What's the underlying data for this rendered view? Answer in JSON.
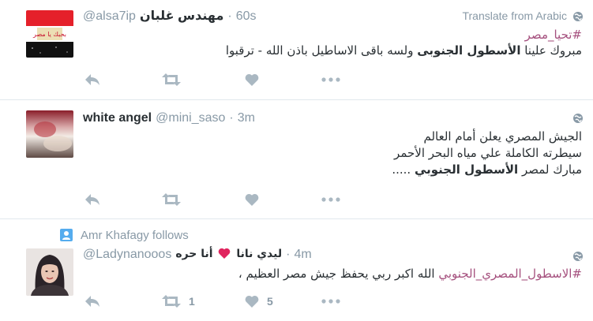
{
  "tweets": [
    {
      "name": "مهندس غلبان",
      "handle": "@alsa7ip",
      "time": "60s",
      "translate": "Translate from Arabic",
      "hashtag": "#تحيا_مصر",
      "text_before": "مبروك علينا ",
      "text_bold": "الأسطول الجنوبى",
      "text_after": " ولسه باقى الاساطيل باذن الله - ترقبوا",
      "avatar_text": "بحبك يا مصر"
    },
    {
      "name": "white angel",
      "handle": "@mini_saso",
      "time": "3m",
      "line1": "الجيش المصري يعلن أمام العالم",
      "line2": "سيطرته الكاملة علي مياه البحر الأحمر",
      "line3_before": "مبارك لمصر ",
      "line3_bold": "الأسطول الجنوبي",
      "line3_after": " ....."
    },
    {
      "follow_text": "Amr Khafagy follows",
      "name_part1": "ليدي نانا",
      "name_part2": "أنا حره",
      "handle": "@Ladynanooos",
      "time": "4m",
      "hashtag": "#الاسطول_المصري_الجنوبي",
      "text_after": " الله اكبر ربي يحفظ جيش مصر العظيم ،",
      "retweet_count": "1",
      "like_count": "5"
    }
  ],
  "icons": {
    "reply": "reply-icon",
    "retweet": "retweet-icon",
    "like": "heart-icon",
    "more": "more-icon",
    "globe": "globe-icon",
    "follow": "person-icon"
  },
  "colors": {
    "hashtag": "#a5507e",
    "muted": "#8899a6",
    "action": "#aab8c2",
    "follow_icon": "#55acee",
    "heart_red": "#e0245e"
  }
}
